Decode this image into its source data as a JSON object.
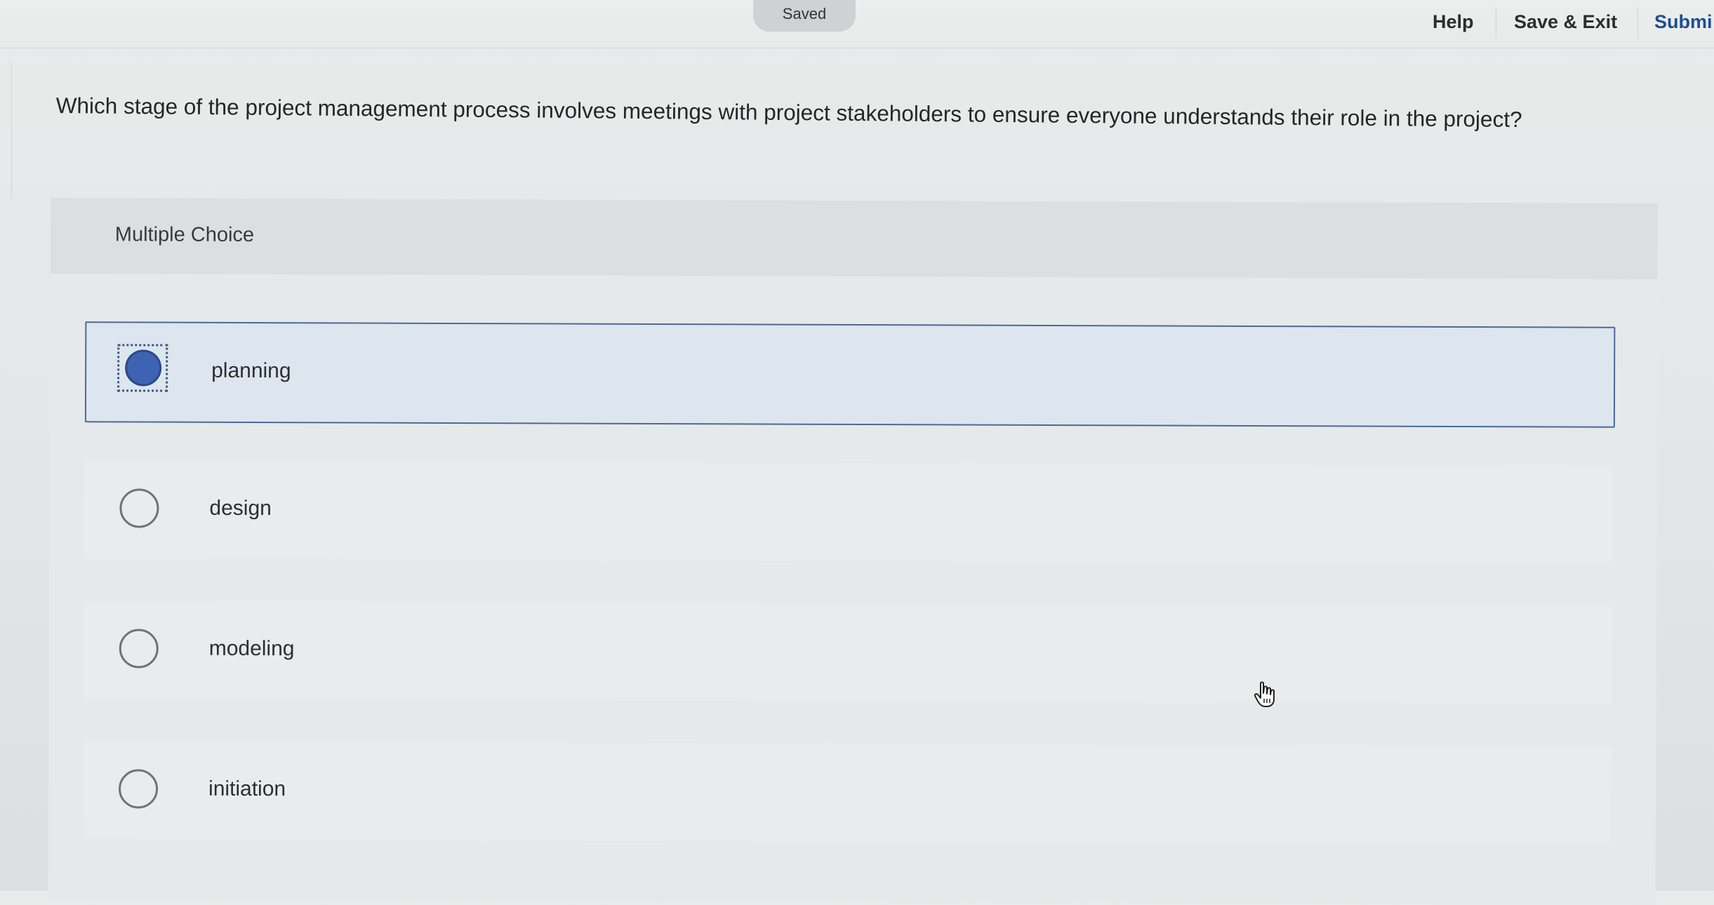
{
  "header": {
    "status_pill": "Saved",
    "nav": {
      "help": "Help",
      "save_exit": "Save & Exit",
      "submit": "Submi"
    }
  },
  "question": {
    "text": "Which stage of the project management process involves meetings with project stakeholders to ensure everyone understands their role in the project?"
  },
  "card": {
    "type_label": "Multiple Choice",
    "options": [
      {
        "label": "planning",
        "selected": true
      },
      {
        "label": "design",
        "selected": false
      },
      {
        "label": "modeling",
        "selected": false
      },
      {
        "label": "initiation",
        "selected": false
      }
    ]
  },
  "colors": {
    "selected_fill": "#3d63b2",
    "selected_border": "#4a6a98",
    "submit_link": "#1d4f8f"
  },
  "icons": {
    "cursor": "hand-pointer-icon",
    "radio_selected": "radio-selected-icon",
    "radio_empty": "radio-empty-icon"
  }
}
